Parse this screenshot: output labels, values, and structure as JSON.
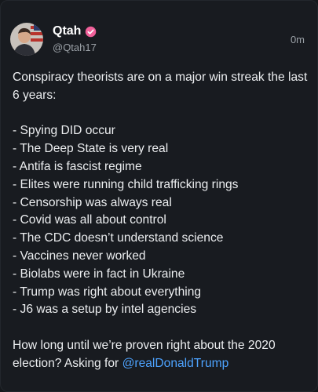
{
  "post": {
    "author": {
      "display_name": "Qtah",
      "handle": "@Qtah17",
      "verified_badge": "pink-check-badge",
      "avatar": "user-avatar-flag"
    },
    "time": "0m",
    "intro": "Conspiracy theorists are on a major win streak the last 6 years:",
    "items": [
      "- Spying DID occur",
      "- The Deep State is very real",
      "- Antifa is fascist regime",
      "- Elites were running child trafficking rings",
      "- Censorship was always real",
      "- Covid was all about control",
      "- The CDC doesn’t understand science",
      "- Vaccines never worked",
      "- Biolabs were in fact in Ukraine",
      "- Trump was right about everything",
      "- J6 was a setup by intel agencies"
    ],
    "closing_text": "How long until we’re proven right about the 2020 election? Asking for ",
    "mention": "@realDonaldTrump"
  },
  "colors": {
    "background": "#181b20",
    "text": "#eceef0",
    "muted": "#9aa0a6",
    "link": "#4da3ff",
    "badge": "#f0609a"
  }
}
